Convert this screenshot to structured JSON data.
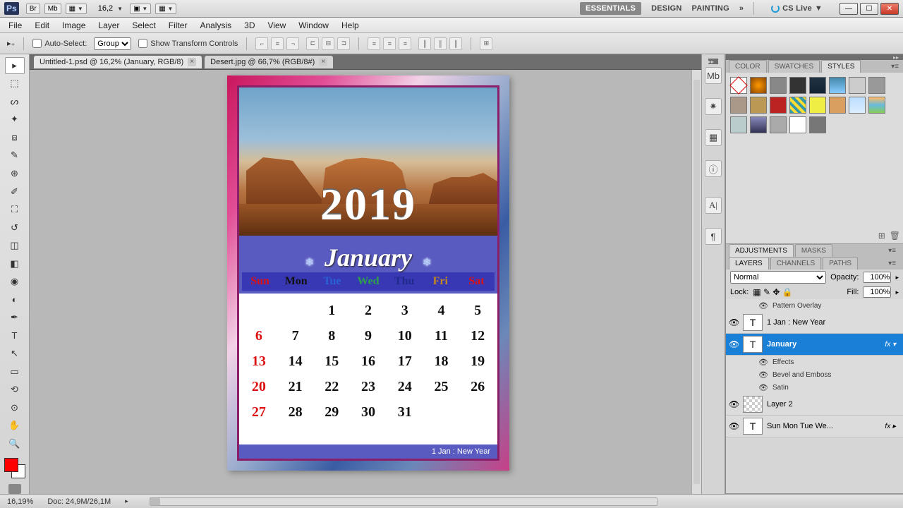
{
  "titlebar": {
    "br": "Br",
    "mb": "Mb",
    "zoom": "16,2",
    "workspaces": [
      "ESSENTIALS",
      "DESIGN",
      "PAINTING"
    ],
    "cslive": "CS Live"
  },
  "menubar": [
    "File",
    "Edit",
    "Image",
    "Layer",
    "Select",
    "Filter",
    "Analysis",
    "3D",
    "View",
    "Window",
    "Help"
  ],
  "optbar": {
    "auto": "Auto-Select:",
    "group": "Group",
    "transform": "Show Transform Controls"
  },
  "doctabs": [
    "Untitled-1.psd @ 16,2% (January, RGB/8)",
    "Desert.jpg @ 66,7% (RGB/8#)"
  ],
  "canvas": {
    "year": "2019",
    "month": "January",
    "dow": [
      "Sun",
      "Mon",
      "Tue",
      "Wed",
      "Thu",
      "Fri",
      "Sat"
    ],
    "dowcolors": [
      "#d11",
      "#111",
      "#2a62d6",
      "#2fa04a",
      "#1f2a8a",
      "#c28a1e",
      "#d11"
    ],
    "weeks": [
      [
        "",
        "",
        "1",
        "2",
        "3",
        "4",
        "5"
      ],
      [
        "6",
        "7",
        "8",
        "9",
        "10",
        "11",
        "12"
      ],
      [
        "13",
        "14",
        "15",
        "16",
        "17",
        "18",
        "19"
      ],
      [
        "20",
        "21",
        "22",
        "23",
        "24",
        "25",
        "26"
      ],
      [
        "27",
        "28",
        "29",
        "30",
        "31",
        "",
        ""
      ]
    ],
    "footer": "1 Jan : New Year"
  },
  "panels": {
    "color_tabs": [
      "COLOR",
      "SWATCHES",
      "STYLES"
    ],
    "adj_tabs": [
      "ADJUSTMENTS",
      "MASKS"
    ],
    "layer_tabs": [
      "LAYERS",
      "CHANNELS",
      "PATHS"
    ],
    "blend": "Normal",
    "opacity_label": "Opacity:",
    "opacity": "100%",
    "lock": "Lock:",
    "fill_label": "Fill:",
    "fill": "100%",
    "layers": {
      "pattern": "Pattern Overlay",
      "newyear": "1 Jan : New Year",
      "january": "January",
      "effects": "Effects",
      "bevel": "Bevel and Emboss",
      "satin": "Satin",
      "layer2": "Layer 2",
      "dowlayer": "Sun   Mon   Tue   We..."
    }
  },
  "status": {
    "zoom": "16,19%",
    "doc": "Doc: 24,9M/26,1M"
  }
}
